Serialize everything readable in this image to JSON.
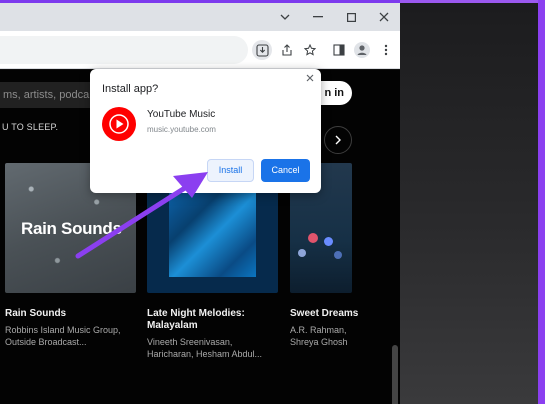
{
  "colors": {
    "accent_purple": "#8b3ff0",
    "install_blue": "#1a73e8",
    "youtube_red": "#ff0000"
  },
  "browser": {
    "window_controls": {
      "chevron": "chevron-down-icon",
      "minimize": "minimize-icon",
      "maximize": "maximize-icon",
      "close": "close-icon"
    },
    "toolbar_icons": [
      "install-app-icon",
      "share-icon",
      "bookmark-star-icon",
      "side-panel-icon",
      "profile-icon",
      "more-menu-icon"
    ]
  },
  "page": {
    "search_placeholder": "ms, artists, podca",
    "signin_label": "n in",
    "section_text": "U TO SLEEP.",
    "cards": [
      {
        "overlay_title": "Rain Sounds",
        "title": "Rain Sounds",
        "subtitle_line1": "Robbins Island Music Group,",
        "subtitle_line2": "Outside Broadcast..."
      },
      {
        "title_line1": "Late Night Melodies:",
        "title_line2": "Malayalam",
        "subtitle_line1": "Vineeth Sreenivasan,",
        "subtitle_line2": "Haricharan, Hesham Abdul..."
      },
      {
        "title": "Sweet Dreams",
        "subtitle_line1": "A.R. Rahman,",
        "subtitle_line2": "Shreya Ghosh"
      }
    ]
  },
  "dialog": {
    "title": "Install app?",
    "app_name": "YouTube Music",
    "app_url": "music.youtube.com",
    "install_label": "Install",
    "cancel_label": "Cancel"
  }
}
